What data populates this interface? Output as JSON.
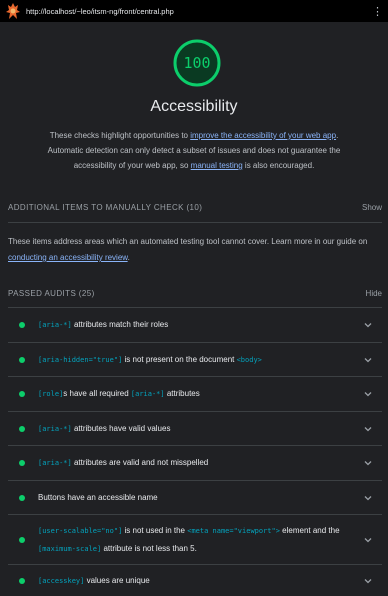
{
  "browser": {
    "url": "http://localhost/~leo/itsm-ng/front/central.php",
    "menu_icon": "kebab-menu-icon"
  },
  "summary": {
    "score": "100",
    "score_color": "#0cce6b",
    "title": "Accessibility",
    "desc_part1": "These checks highlight opportunities to ",
    "desc_link1": "improve the accessibility of your web app",
    "desc_part2": ". Automatic detection can only detect a subset of issues and does not guarantee the accessibility of your web app, so ",
    "desc_link2": "manual testing",
    "desc_part3": " is also encouraged."
  },
  "manual": {
    "heading": "ADDITIONAL ITEMS TO MANUALLY CHECK (10)",
    "toggle": "Show",
    "desc_part1": "These items address areas which an automated testing tool cannot cover. Learn more in our guide on ",
    "desc_link": "conducting an accessibility review",
    "desc_part2": "."
  },
  "passed": {
    "heading": "PASSED AUDITS (25)",
    "toggle": "Hide",
    "audits": [
      {
        "code1": "[aria-*]",
        "text1": " attributes match their roles"
      },
      {
        "code1": "[aria-hidden=\"true\"]",
        "text1": " is not present on the document ",
        "code2": "<body>"
      },
      {
        "code1": "[role]",
        "text1": "s have all required ",
        "code2": "[aria-*]",
        "text2": " attributes"
      },
      {
        "code1": "[aria-*]",
        "text1": " attributes have valid values"
      },
      {
        "code1": "[aria-*]",
        "text1": " attributes are valid and not misspelled"
      },
      {
        "text1": "Buttons have an accessible name"
      },
      {
        "code1": "[user-scalable=\"no\"]",
        "text1": " is not used in the ",
        "code2": "<meta name=\"viewport\">",
        "text2": " element and the ",
        "code3": "[maximum-scale]",
        "text3": " attribute is not less than 5."
      },
      {
        "code1": "[accesskey]",
        "text1": " values are unique"
      }
    ]
  }
}
